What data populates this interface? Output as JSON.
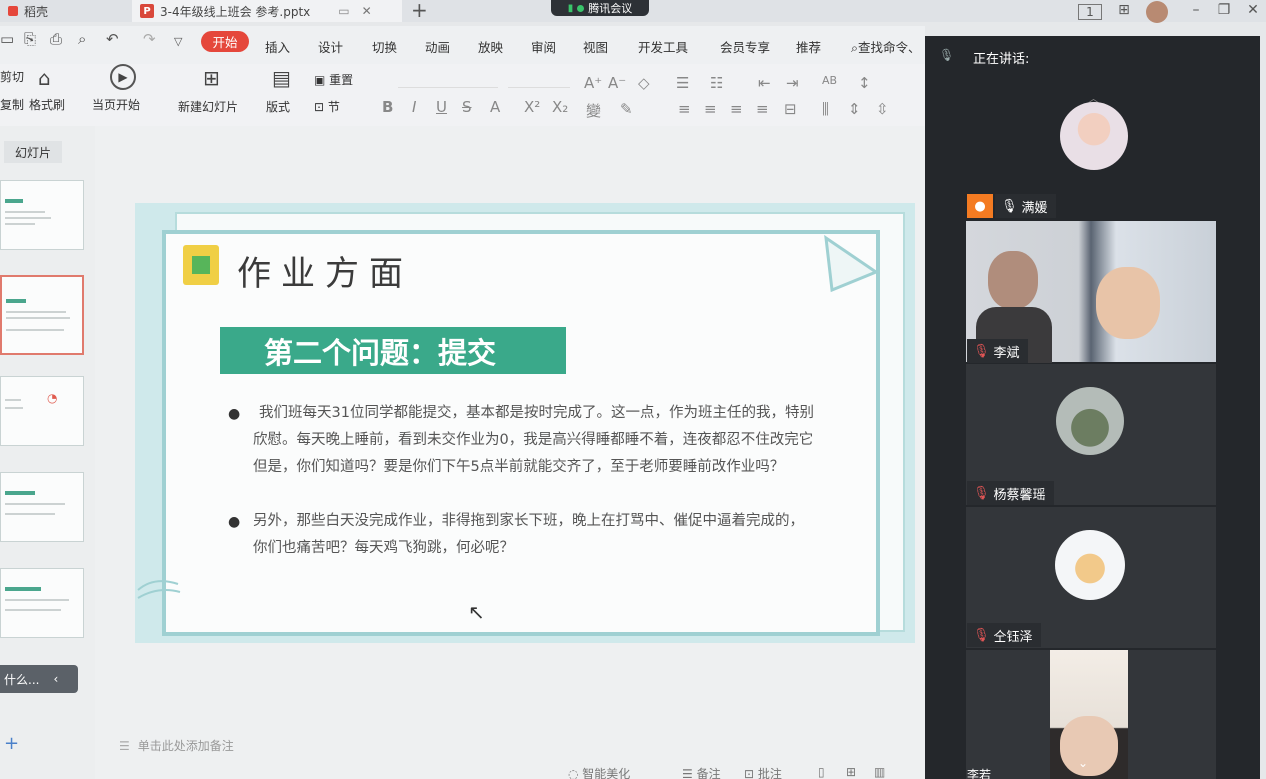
{
  "titlebar": {
    "tab_prev": "稻壳",
    "tab_active": "3-4年级线上班会 参考.pptx",
    "ppt_badge": "P",
    "new_tab": "+",
    "meeting_app": "腾讯会议"
  },
  "menu": {
    "items": [
      "开始",
      "插入",
      "设计",
      "切换",
      "动画",
      "放映",
      "审阅",
      "视图",
      "开发工具",
      "会员专享",
      "推荐"
    ],
    "search": "查找命令、"
  },
  "ribbon": {
    "cut": "剪切",
    "copy": "复制",
    "format_painter": "格式刷",
    "play_from_current": "当页开始",
    "new_slide": "新建幻灯片",
    "layout": "版式",
    "reset": "重置",
    "section": "节"
  },
  "left_panel": {
    "tab": "幻灯片",
    "search_hint": "什么..."
  },
  "slide": {
    "title": "作业方面",
    "subtitle": "第二个问题：提交",
    "bullet1": [
      "我们班每天31位同学都能提交，基本都是按时完成了。这一点，作为班主任的我，特别",
      "欣慰。每天晚上睡前，看到未交作业为0，我是高兴得睡都睡不着，连夜都忍不住改完它",
      "但是，你们知道吗？要是你们下午5点半前就能交齐了，至于老师要睡前改作业吗？"
    ],
    "bullet2": [
      "另外，那些白天没完成作业，非得拖到家长下班，晚上在打骂中、催促中逼着完成的，",
      "你们也痛苦吧？每天鸡飞狗跳，何必呢？"
    ]
  },
  "notes": {
    "placeholder": "单击此处添加备注"
  },
  "statusbar": {
    "beautify": "智能美化",
    "remarks": "备注",
    "annotate": "批注"
  },
  "meeting": {
    "speaking_label": "正在讲话:",
    "participants": [
      "满媛",
      "李斌",
      "杨蔡馨瑶",
      "仝钰泽",
      "李若"
    ]
  },
  "colors": {
    "accent_red": "#e5473b",
    "slide_green": "#3aa98a",
    "meeting_bg": "#24272b"
  }
}
